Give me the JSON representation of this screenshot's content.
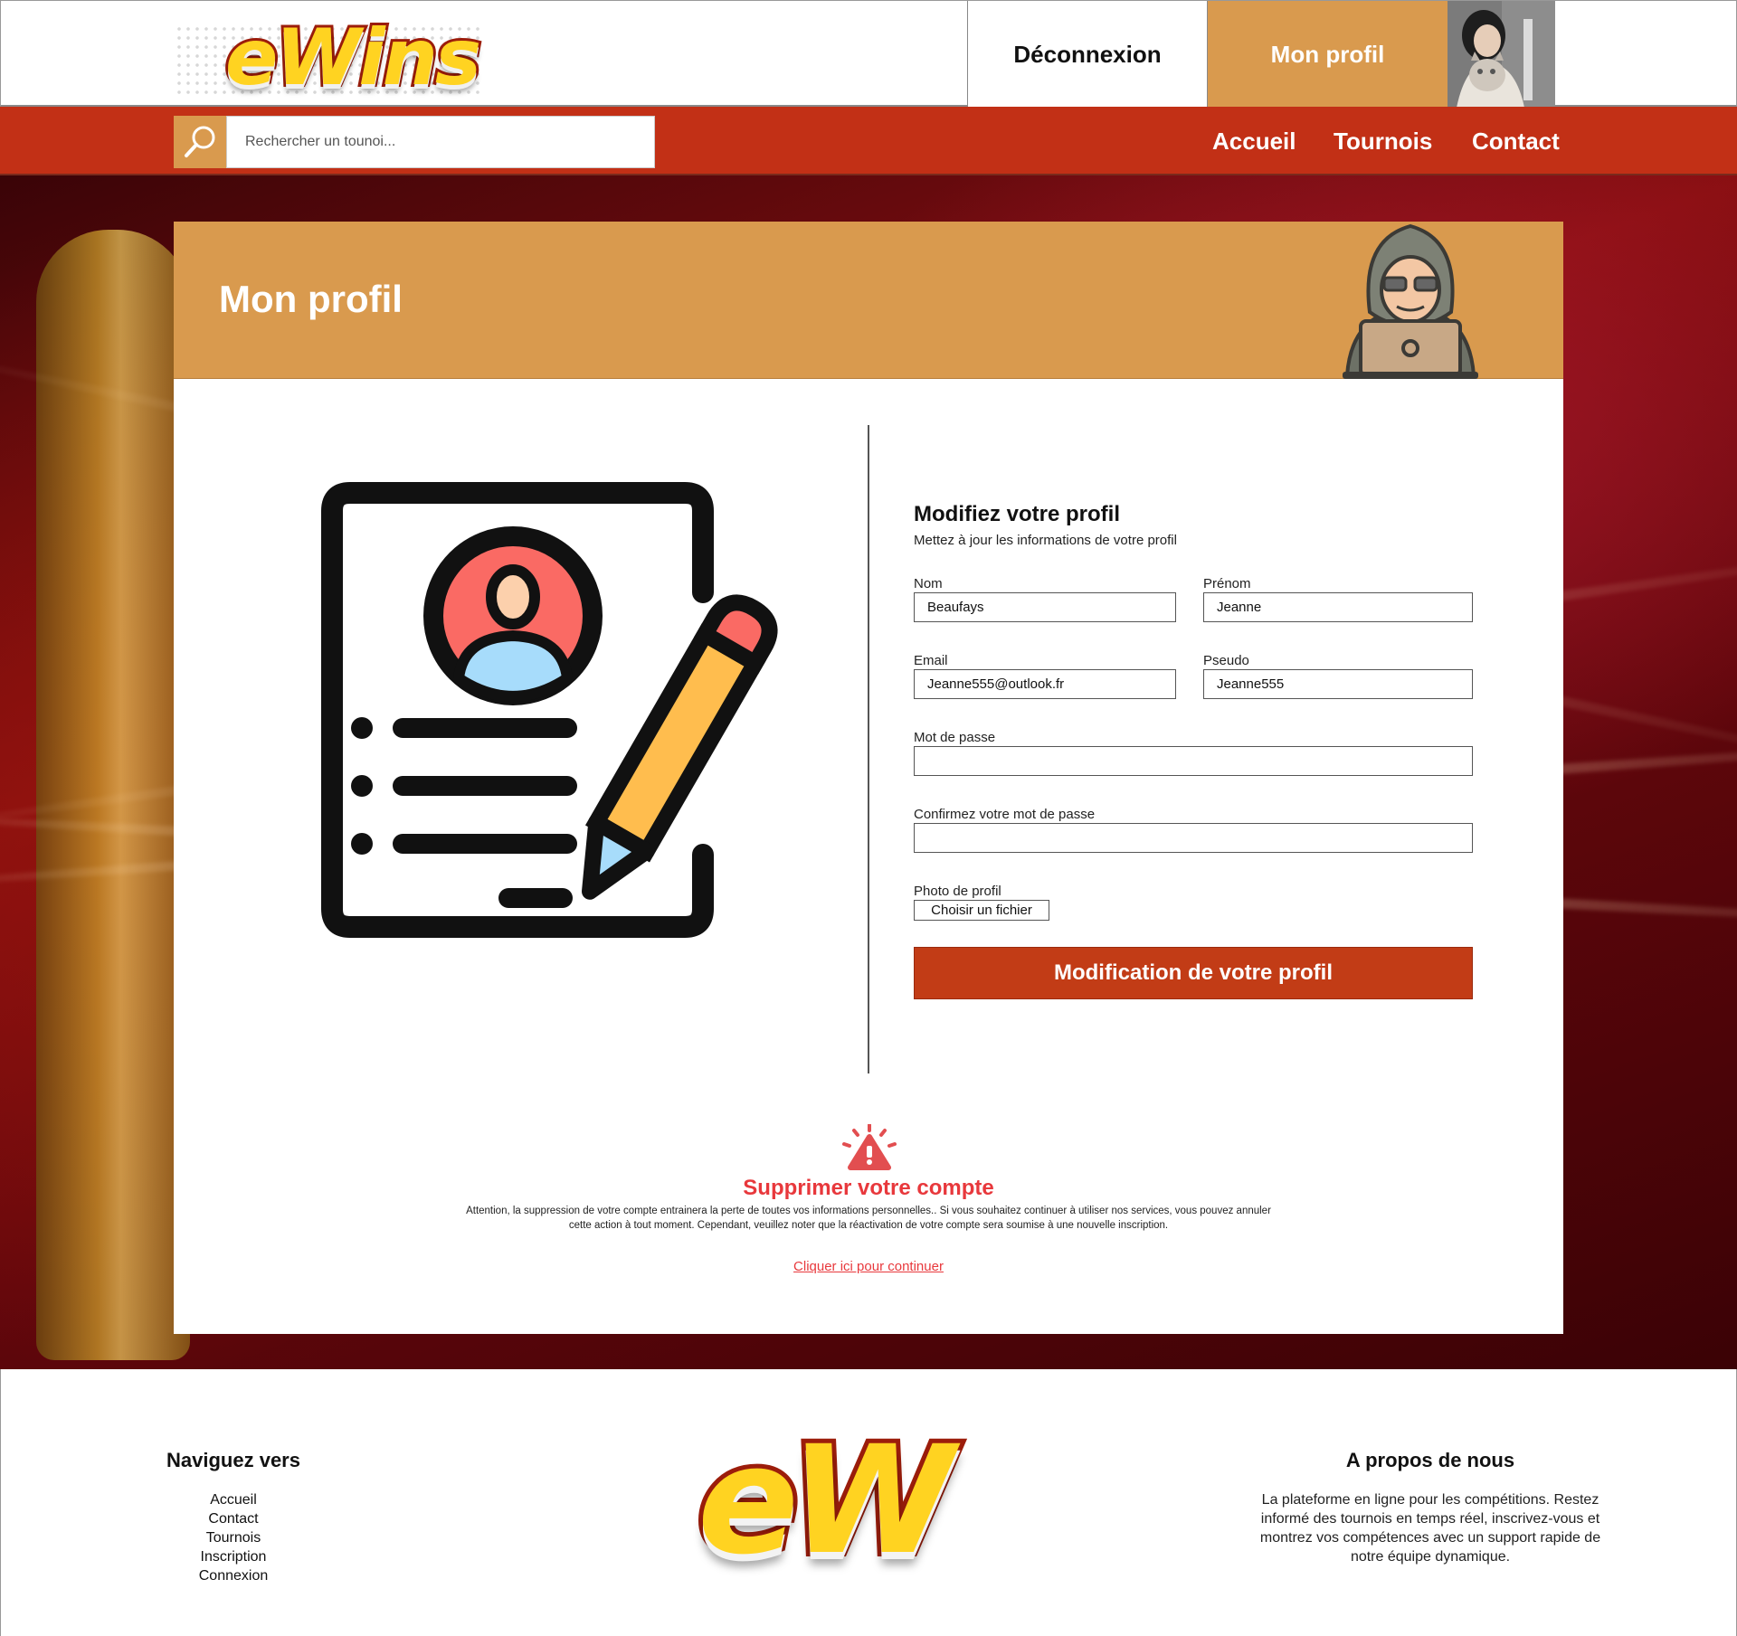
{
  "header": {
    "logo_text": "eWins",
    "logout_label": "Déconnexion",
    "profile_label": "Mon profil"
  },
  "nav": {
    "search_placeholder": "Rechercher un tounoi...",
    "links": [
      "Accueil",
      "Tournois",
      "Contact"
    ]
  },
  "card": {
    "title": "Mon profil",
    "form": {
      "title": "Modifiez votre profil",
      "subtitle": "Mettez à jour les informations de votre profil",
      "nom_label": "Nom",
      "nom_value": "Beaufays",
      "prenom_label": "Prénom",
      "prenom_value": "Jeanne",
      "email_label": "Email",
      "email_value": "Jeanne555@outlook.fr",
      "pseudo_label": "Pseudo",
      "pseudo_value": "Jeanne555",
      "password_label": "Mot de passe",
      "password_value": "",
      "confirm_label": "Confirmez votre mot de passe",
      "confirm_value": "",
      "photo_label": "Photo de profil",
      "file_button": "Choisir un fichier",
      "submit_label": "Modification de votre profil"
    },
    "delete": {
      "title": "Supprimer votre compte",
      "text": "Attention, la suppression de votre compte entrainera la perte de toutes vos informations personnelles.. Si vous souhaitez continuer à utiliser nos services, vous pouvez annuler cette action à tout moment. Cependant, veuillez noter que la réactivation de votre compte sera soumise à une nouvelle inscription.",
      "link": "Cliquer ici pour continuer"
    }
  },
  "footer": {
    "nav_title": "Naviguez vers",
    "nav_links": [
      "Accueil",
      "Contact",
      "Tournois",
      "Inscription",
      "Connexion"
    ],
    "logo_text": "eW",
    "about_title": "A propos de nous",
    "about_text": "La plateforme en ligne pour les compétitions. Restez informé des tournois en temps réel, inscrivez-vous et montrez vos compétences avec un support rapide de notre équipe dynamique."
  },
  "colors": {
    "accent_orange": "#d99a4e",
    "nav_red": "#c23016",
    "submit_red": "#c23c16",
    "danger_red": "#e8383c"
  },
  "icons": [
    "search-icon",
    "avatar-photo",
    "hacker-icon",
    "profile-edit-illustration",
    "warning-icon"
  ]
}
